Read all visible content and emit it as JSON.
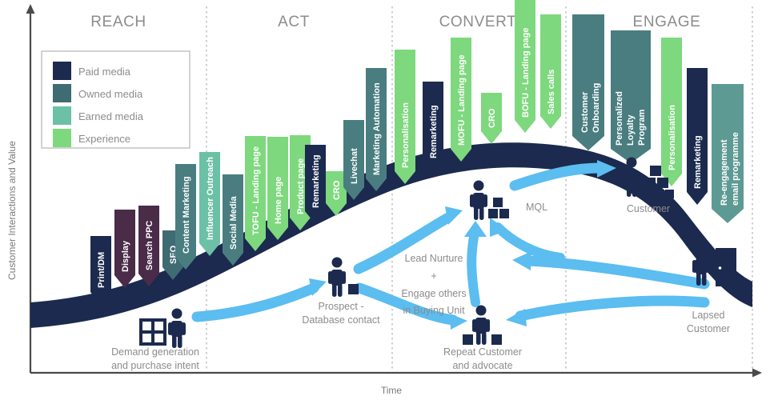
{
  "axes": {
    "y_label": "Customer Interactions and Value",
    "x_label": "Time"
  },
  "legend": {
    "items": [
      {
        "label": "Paid media",
        "color": "#1b2a4e"
      },
      {
        "label": "Owned media",
        "color": "#3f6b72"
      },
      {
        "label": "Earned media",
        "color": "#6cc0a5"
      },
      {
        "label": "Experience",
        "color": "#7ed87e"
      }
    ]
  },
  "stages": [
    {
      "title": "REACH"
    },
    {
      "title": "ACT"
    },
    {
      "title": "CONVERT"
    },
    {
      "title": "ENGAGE"
    }
  ],
  "tactics": [
    {
      "label": "Print/DM",
      "color": "#1b2a4e",
      "category": "Paid media"
    },
    {
      "label": "Display",
      "color": "#4a2b48",
      "category": "Paid media"
    },
    {
      "label": "Search PPC",
      "color": "#4a2b48",
      "category": "Paid media"
    },
    {
      "label": "SEO",
      "color": "#3f6b72",
      "category": "Owned media"
    },
    {
      "label": "Content Marketing",
      "color": "#4a7d80",
      "category": "Owned media"
    },
    {
      "label": "Influencer Outreach",
      "color": "#6cc0a5",
      "category": "Earned media"
    },
    {
      "label": "Social Media",
      "color": "#4a7d80",
      "category": "Owned media"
    },
    {
      "label": "TOFU - Landing page",
      "color": "#7ed87e",
      "category": "Experience"
    },
    {
      "label": "Home page",
      "color": "#7ed87e",
      "category": "Experience"
    },
    {
      "label": "Product page",
      "color": "#7ed87e",
      "category": "Experience"
    },
    {
      "label": "Remarketing",
      "color": "#1b2a4e",
      "category": "Paid media"
    },
    {
      "label": "CRO",
      "color": "#7ed87e",
      "category": "Experience"
    },
    {
      "label": "Livechat",
      "color": "#4a7d80",
      "category": "Owned media"
    },
    {
      "label": "Marketing Automation",
      "color": "#4a7d80",
      "category": "Owned media"
    },
    {
      "label": "Personalisation",
      "color": "#7ed87e",
      "category": "Experience"
    },
    {
      "label": "Remarketing",
      "color": "#1b2a4e",
      "category": "Paid media"
    },
    {
      "label": "MOFU - Landing page",
      "color": "#7ed87e",
      "category": "Experience"
    },
    {
      "label": "CRO",
      "color": "#7ed87e",
      "category": "Experience"
    },
    {
      "label": "BOFU - Landing page",
      "color": "#7ed87e",
      "category": "Experience"
    },
    {
      "label": "Sales calls",
      "color": "#7ed87e",
      "category": "Experience"
    },
    {
      "label": "Customer Onboarding",
      "color": "#4a7d80",
      "category": "Owned media"
    },
    {
      "label": "Personalized Loyalty Program",
      "color": "#4a7d80",
      "category": "Owned media"
    },
    {
      "label": "Personalisation",
      "color": "#7ed87e",
      "category": "Experience"
    },
    {
      "label": "Remarketing",
      "color": "#1b2a4e",
      "category": "Paid media"
    },
    {
      "label": "Re-engagement email programme",
      "color": "#5d9a93",
      "category": "Owned media"
    }
  ],
  "personas": [
    {
      "id": "demand",
      "label": "Demand generation\nand purchase intent",
      "line1": "Demand generation",
      "line2": "and purchase intent"
    },
    {
      "id": "prospect",
      "label": "Prospect -\nDatabase contact",
      "line1": "Prospect  -",
      "line2": "Database contact"
    },
    {
      "id": "mql",
      "label": "MQL",
      "line1": "MQL",
      "line2": ""
    },
    {
      "id": "repeat",
      "label": "Repeat Customer\nand advocate",
      "line1": "Repeat Customer",
      "line2": "and advocate"
    },
    {
      "id": "customer",
      "label": "Customer",
      "line1": "Customer",
      "line2": ""
    },
    {
      "id": "lapsed",
      "label": "Lapsed\nCustomer",
      "line1": "Lapsed",
      "line2": "Customer"
    }
  ],
  "flow_annotations": {
    "lead_nurture_line1": "Lead Nurture",
    "lead_nurture_line2": "+",
    "lead_nurture_line3": "Engage others",
    "lead_nurture_line4": "in Buying Unit"
  },
  "colors": {
    "wave": "#1b2a4e",
    "flow_arrow": "#5bbdf0",
    "axis": "#5a5a5a",
    "divider": "#bdbdbd",
    "text_muted": "#8c8c8c"
  }
}
